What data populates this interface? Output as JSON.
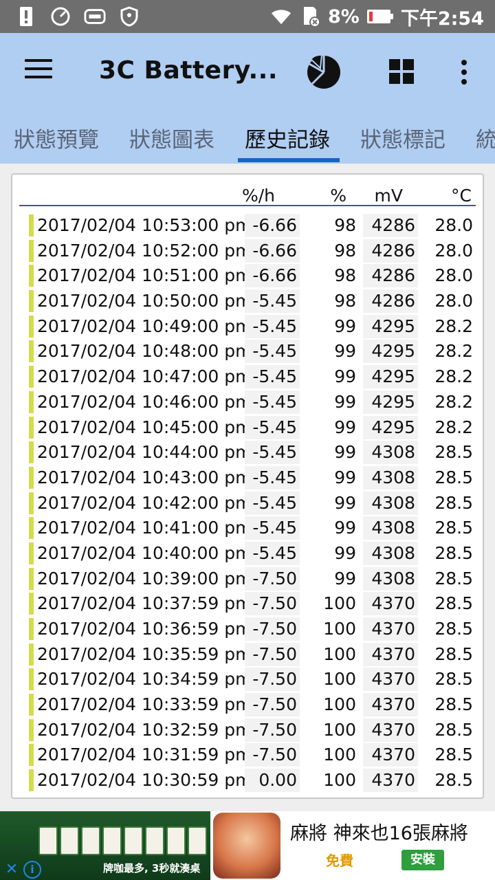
{
  "status_bar": {
    "battery_percent": "8%",
    "time": "下午2:54"
  },
  "app_bar": {
    "title": "3C Battery..."
  },
  "tabs": [
    {
      "label": "狀態預覽",
      "active": false
    },
    {
      "label": "狀態圖表",
      "active": false
    },
    {
      "label": "歷史記錄",
      "active": true
    },
    {
      "label": "狀態標記",
      "active": false
    },
    {
      "label": "統",
      "active": false
    }
  ],
  "table": {
    "headers": {
      "rate": "%/h",
      "percent": "%",
      "mv": "mV",
      "temp": "°C"
    },
    "rows": [
      {
        "time": "2017/02/04 10:53:00 pm",
        "rate": "-6.66",
        "percent": "98",
        "mv": "4286",
        "temp": "28.0"
      },
      {
        "time": "2017/02/04 10:52:00 pm",
        "rate": "-6.66",
        "percent": "98",
        "mv": "4286",
        "temp": "28.0"
      },
      {
        "time": "2017/02/04 10:51:00 pm",
        "rate": "-6.66",
        "percent": "98",
        "mv": "4286",
        "temp": "28.0"
      },
      {
        "time": "2017/02/04 10:50:00 pm",
        "rate": "-5.45",
        "percent": "98",
        "mv": "4286",
        "temp": "28.0"
      },
      {
        "time": "2017/02/04 10:49:00 pm",
        "rate": "-5.45",
        "percent": "99",
        "mv": "4295",
        "temp": "28.2"
      },
      {
        "time": "2017/02/04 10:48:00 pm",
        "rate": "-5.45",
        "percent": "99",
        "mv": "4295",
        "temp": "28.2"
      },
      {
        "time": "2017/02/04 10:47:00 pm",
        "rate": "-5.45",
        "percent": "99",
        "mv": "4295",
        "temp": "28.2"
      },
      {
        "time": "2017/02/04 10:46:00 pm",
        "rate": "-5.45",
        "percent": "99",
        "mv": "4295",
        "temp": "28.2"
      },
      {
        "time": "2017/02/04 10:45:00 pm",
        "rate": "-5.45",
        "percent": "99",
        "mv": "4295",
        "temp": "28.2"
      },
      {
        "time": "2017/02/04 10:44:00 pm",
        "rate": "-5.45",
        "percent": "99",
        "mv": "4308",
        "temp": "28.5"
      },
      {
        "time": "2017/02/04 10:43:00 pm",
        "rate": "-5.45",
        "percent": "99",
        "mv": "4308",
        "temp": "28.5"
      },
      {
        "time": "2017/02/04 10:42:00 pm",
        "rate": "-5.45",
        "percent": "99",
        "mv": "4308",
        "temp": "28.5"
      },
      {
        "time": "2017/02/04 10:41:00 pm",
        "rate": "-5.45",
        "percent": "99",
        "mv": "4308",
        "temp": "28.5"
      },
      {
        "time": "2017/02/04 10:40:00 pm",
        "rate": "-5.45",
        "percent": "99",
        "mv": "4308",
        "temp": "28.5"
      },
      {
        "time": "2017/02/04 10:39:00 pm",
        "rate": "-7.50",
        "percent": "99",
        "mv": "4308",
        "temp": "28.5"
      },
      {
        "time": "2017/02/04 10:37:59 pm",
        "rate": "-7.50",
        "percent": "100",
        "mv": "4370",
        "temp": "28.5"
      },
      {
        "time": "2017/02/04 10:36:59 pm",
        "rate": "-7.50",
        "percent": "100",
        "mv": "4370",
        "temp": "28.5"
      },
      {
        "time": "2017/02/04 10:35:59 pm",
        "rate": "-7.50",
        "percent": "100",
        "mv": "4370",
        "temp": "28.5"
      },
      {
        "time": "2017/02/04 10:34:59 pm",
        "rate": "-7.50",
        "percent": "100",
        "mv": "4370",
        "temp": "28.5"
      },
      {
        "time": "2017/02/04 10:33:59 pm",
        "rate": "-7.50",
        "percent": "100",
        "mv": "4370",
        "temp": "28.5"
      },
      {
        "time": "2017/02/04 10:32:59 pm",
        "rate": "-7.50",
        "percent": "100",
        "mv": "4370",
        "temp": "28.5"
      },
      {
        "time": "2017/02/04 10:31:59 pm",
        "rate": "-7.50",
        "percent": "100",
        "mv": "4370",
        "temp": "28.5"
      },
      {
        "time": "2017/02/04 10:30:59 pm",
        "rate": "0.00",
        "percent": "100",
        "mv": "4370",
        "temp": "28.5"
      }
    ],
    "marker_color": "#d4dc4a"
  },
  "ad": {
    "image_slogan": "牌咖最多, 3秒就湊桌",
    "title": "麻將 神來也16張麻將",
    "free_label": "免費",
    "install_label": "安裝"
  },
  "colors": {
    "app_bar": "#b0cdf2",
    "tab_indicator": "#1565c0",
    "status_bar": "#6e6e6e"
  }
}
